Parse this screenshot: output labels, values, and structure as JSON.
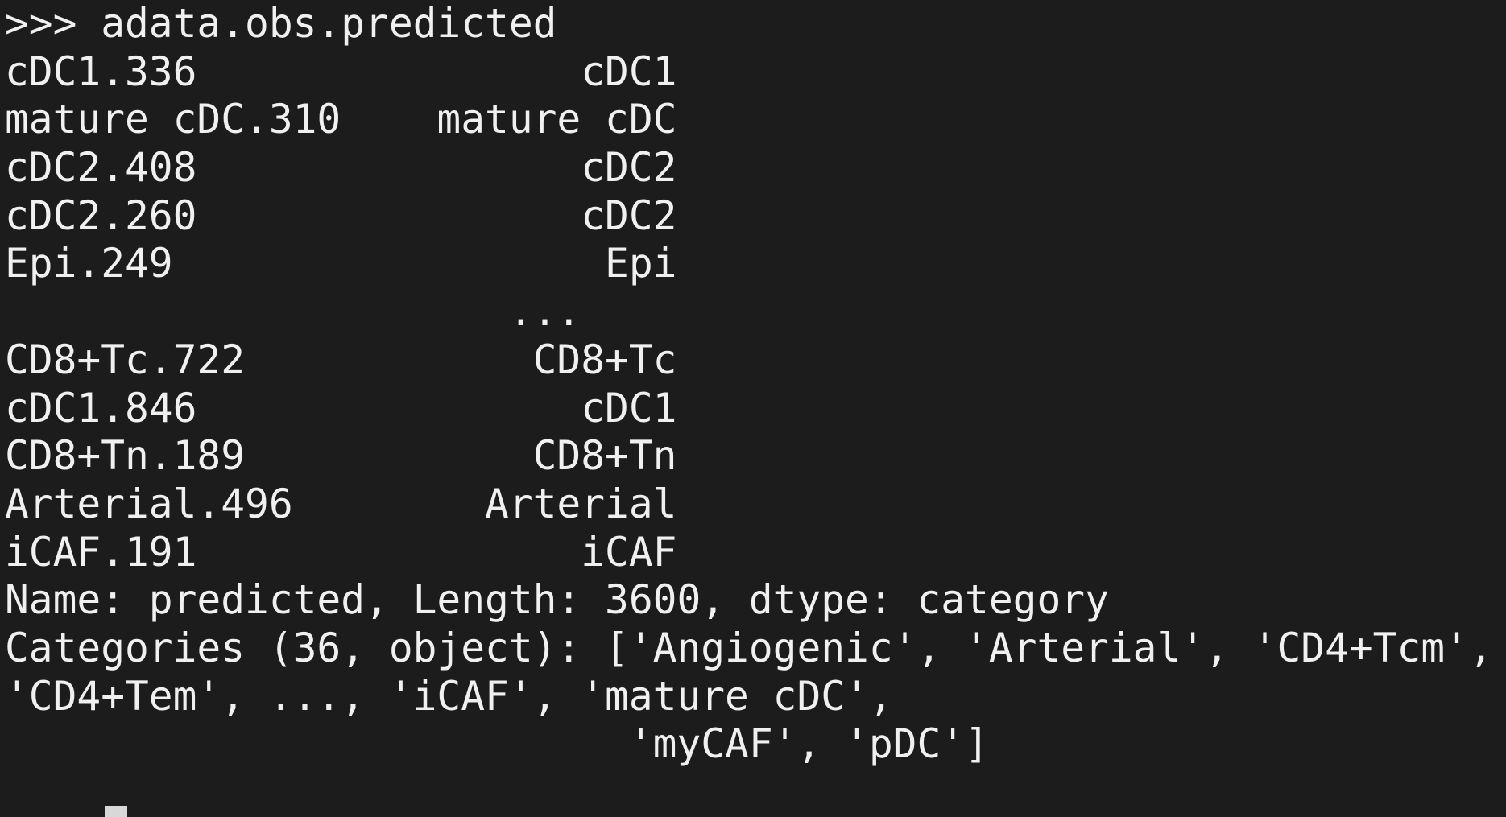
{
  "terminal": {
    "lines": [
      ">>> adata.obs.predicted",
      "cDC1.336                cDC1",
      "mature cDC.310    mature cDC",
      "cDC2.408                cDC2",
      "cDC2.260                cDC2",
      "Epi.249                  Epi",
      "                     ...",
      "CD8+Tc.722            CD8+Tc",
      "cDC1.846                cDC1",
      "CD8+Tn.189            CD8+Tn",
      "Arterial.496        Arterial",
      "iCAF.191                iCAF",
      "Name: predicted, Length: 3600, dtype: category",
      "Categories (36, object): ['Angiogenic', 'Arterial', 'CD4+Tcm',",
      "'CD4+Tem', ..., 'iCAF', 'mature cDC',",
      "                          'myCAF', 'pDC']"
    ]
  }
}
